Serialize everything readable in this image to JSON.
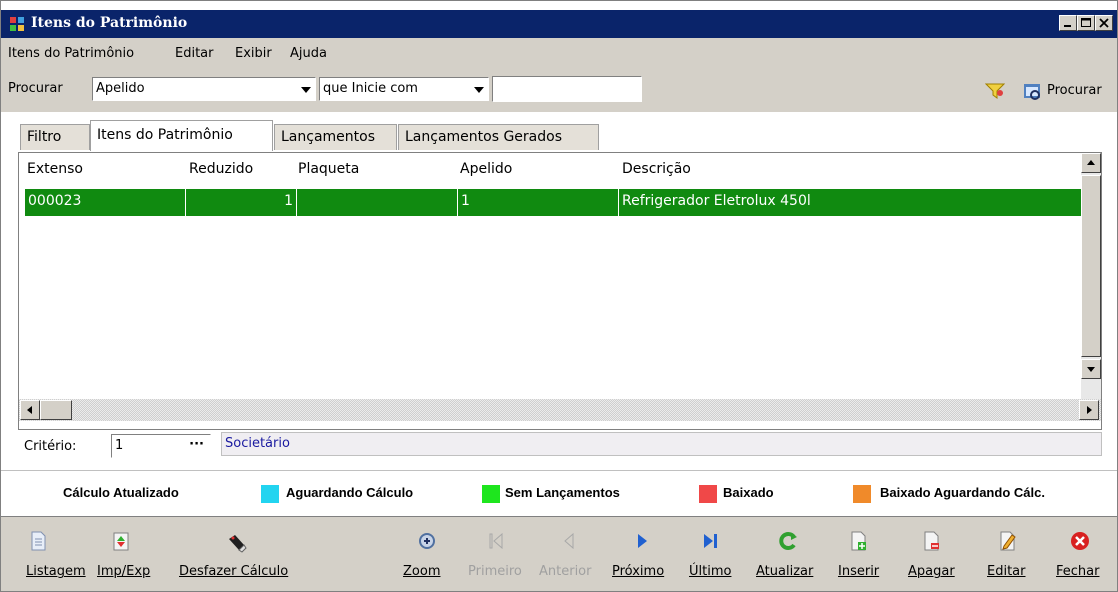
{
  "window": {
    "title": "Itens do Patrimônio"
  },
  "menu": [
    "Itens do Patrimônio",
    "Editar",
    "Exibir",
    "Ajuda"
  ],
  "search": {
    "label": "Procurar",
    "field": "Apelido",
    "mode": "que Inicie com",
    "value": "",
    "button": "Procurar"
  },
  "tabs": [
    {
      "label": "Filtro",
      "active": false
    },
    {
      "label": "Itens do Patrimônio",
      "active": true
    },
    {
      "label": "Lançamentos",
      "active": false
    },
    {
      "label": "Lançamentos Gerados",
      "active": false
    }
  ],
  "grid": {
    "columns": [
      "Extenso",
      "Reduzido",
      "Plaqueta",
      "Apelido",
      "Descrição"
    ],
    "rows": [
      {
        "extenso": "000023",
        "reduzido": "1",
        "plaqueta": "",
        "apelido": "1",
        "descricao": "Refrigerador Eletrolux 450l"
      }
    ],
    "row_color": "#108a10"
  },
  "criteria": {
    "label": "Critério:",
    "value": "1",
    "description": "Societário"
  },
  "legend": [
    {
      "label": "Cálculo Atualizado",
      "color": ""
    },
    {
      "label": "Aguardando Cálculo",
      "color": "#22d4f0"
    },
    {
      "label": "Sem Lançamentos",
      "color": "#1ee61e"
    },
    {
      "label": "Baixado",
      "color": "#f04848"
    },
    {
      "label": "Baixado Aguardando Cálc.",
      "color": "#f08a2a"
    }
  ],
  "toolbar": [
    {
      "label": "Listagem",
      "icon": "document-icon",
      "enabled": true
    },
    {
      "label": "Imp/Exp",
      "icon": "import-export-icon",
      "enabled": true
    },
    {
      "label": "Desfazer Cálculo",
      "icon": "eraser-icon",
      "enabled": true
    },
    {
      "label": "Zoom",
      "icon": "zoom-icon",
      "enabled": true
    },
    {
      "label": "Primeiro",
      "icon": "first-icon",
      "enabled": false
    },
    {
      "label": "Anterior",
      "icon": "previous-icon",
      "enabled": false
    },
    {
      "label": "Próximo",
      "icon": "next-icon",
      "enabled": true
    },
    {
      "label": "Último",
      "icon": "last-icon",
      "enabled": true
    },
    {
      "label": "Atualizar",
      "icon": "refresh-icon",
      "enabled": true
    },
    {
      "label": "Inserir",
      "icon": "insert-icon",
      "enabled": true
    },
    {
      "label": "Apagar",
      "icon": "delete-icon",
      "enabled": true
    },
    {
      "label": "Editar",
      "icon": "edit-icon",
      "enabled": true
    },
    {
      "label": "Fechar",
      "icon": "close-icon",
      "enabled": true
    }
  ]
}
